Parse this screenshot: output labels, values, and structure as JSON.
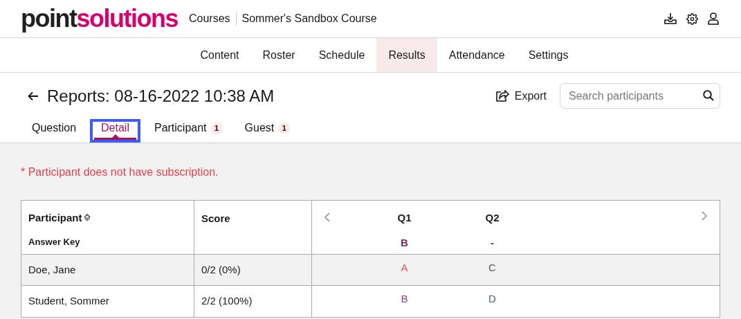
{
  "logo": {
    "part_1": "point",
    "part_2": "solutions"
  },
  "breadcrumb": [
    "Courses",
    "Sommer's Sandbox Course"
  ],
  "nav": [
    {
      "label": "Content",
      "selected": false
    },
    {
      "label": "Roster",
      "selected": false
    },
    {
      "label": "Schedule",
      "selected": false
    },
    {
      "label": "Results",
      "selected": true
    },
    {
      "label": "Attendance",
      "selected": false
    },
    {
      "label": "Settings",
      "selected": false
    }
  ],
  "page_title": "Reports: 08-16-2022 10:38 AM",
  "export_label": "Export",
  "search": {
    "placeholder": "Search participants"
  },
  "tabs": [
    {
      "label": "Question",
      "selected": false,
      "focused": false
    },
    {
      "label": "Detail",
      "selected": true,
      "focused": true
    },
    {
      "label": "Participant",
      "selected": false,
      "focused": false,
      "badge": "1"
    },
    {
      "label": "Guest",
      "selected": false,
      "focused": false,
      "badge": "1"
    }
  ],
  "notice": "* Participant does not have subscription.",
  "table": {
    "columns": [
      "Participant",
      "Score"
    ],
    "answer_key_label": "Answer Key",
    "questions": [
      {
        "label": "Q1",
        "key": "B"
      },
      {
        "label": "Q2",
        "key": "-"
      }
    ],
    "rows": [
      {
        "participant": "Doe, Jane",
        "score": "0/2 (0%)",
        "highlighted": true,
        "answers": [
          {
            "text": "A",
            "kind": "incorrect"
          },
          {
            "text": "C",
            "kind": "ungraded"
          }
        ]
      },
      {
        "participant": "Student, Sommer",
        "score": "2/2 (100%)",
        "highlighted": false,
        "answers": [
          {
            "text": "B",
            "kind": "correct"
          },
          {
            "text": "D",
            "kind": "ungraded"
          }
        ]
      }
    ]
  }
}
